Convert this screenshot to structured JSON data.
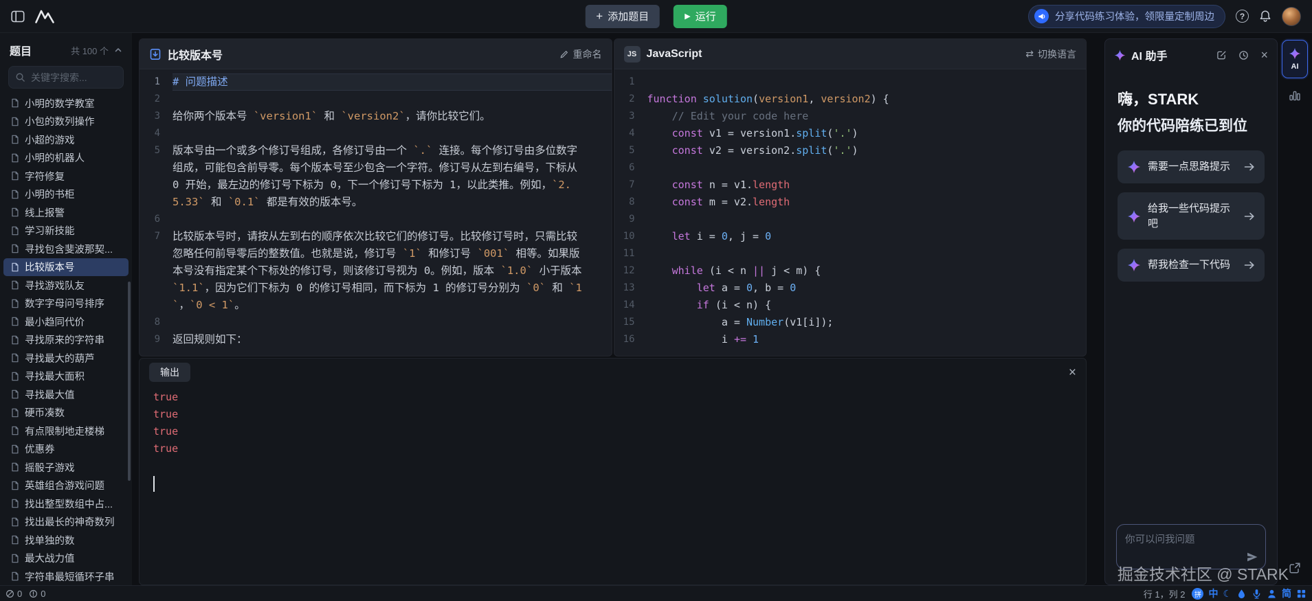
{
  "icons": {
    "plus": "+",
    "play": "▶",
    "help": "?",
    "swap": "⇄",
    "close": "×",
    "badge_js": "JS"
  },
  "topbar": {
    "add_question_label": "添加题目",
    "run_label": "运行",
    "banner_text": "分享代码练习体验，领限量定制周边"
  },
  "sidebar": {
    "title": "题目",
    "count_label": "共 100 个",
    "search_placeholder": "关键字搜索...",
    "items": [
      {
        "label": "小明的数学教室"
      },
      {
        "label": "小包的数列操作"
      },
      {
        "label": "小超的游戏"
      },
      {
        "label": "小明的机器人"
      },
      {
        "label": "字符修复"
      },
      {
        "label": "小明的书柜"
      },
      {
        "label": "线上报警"
      },
      {
        "label": "学习新技能"
      },
      {
        "label": "寻找包含斐波那契..."
      },
      {
        "label": "比较版本号",
        "active": true
      },
      {
        "label": "寻找游戏队友"
      },
      {
        "label": "数字字母问号排序"
      },
      {
        "label": "最小趋同代价"
      },
      {
        "label": "寻找原来的字符串"
      },
      {
        "label": "寻找最大的葫芦"
      },
      {
        "label": "寻找最大面积"
      },
      {
        "label": "寻找最大值"
      },
      {
        "label": "硬币凑数"
      },
      {
        "label": "有点限制地走楼梯"
      },
      {
        "label": "优惠券"
      },
      {
        "label": "摇骰子游戏"
      },
      {
        "label": "英雄组合游戏问题"
      },
      {
        "label": "找出整型数组中占..."
      },
      {
        "label": "找出最长的神奇数列"
      },
      {
        "label": "找单独的数"
      },
      {
        "label": "最大战力值"
      },
      {
        "label": "字符串最短循环子串"
      }
    ]
  },
  "problem": {
    "title": "比较版本号",
    "rename_label": "重命名",
    "lines": [
      {
        "no": 1,
        "active": true,
        "segs": [
          {
            "c": "head",
            "t": "# 问题描述"
          }
        ]
      },
      {
        "no": 2,
        "segs": []
      },
      {
        "no": 3,
        "segs": [
          {
            "c": "txt",
            "t": "给你两个版本号 "
          },
          {
            "c": "code",
            "t": "`version1`"
          },
          {
            "c": "txt",
            "t": " 和 "
          },
          {
            "c": "code",
            "t": "`version2`"
          },
          {
            "c": "txt",
            "t": "，请你比较它们。"
          }
        ]
      },
      {
        "no": 4,
        "segs": []
      },
      {
        "no": 5,
        "segs": [
          {
            "c": "txt",
            "t": "版本号由一个或多个修订号组成，各修订号由一个 "
          },
          {
            "c": "code",
            "t": "`.`"
          },
          {
            "c": "txt",
            "t": " 连接。每个修订号由多位数字组成，可能包含前导零。每个版本号至少包含一个字符。修订号从左到右编号，下标从 0 开始，最左边的修订号下标为 0，下一个修订号下标为 1，以此类推。例如，"
          },
          {
            "c": "code",
            "t": "`2.5.33`"
          },
          {
            "c": "txt",
            "t": " 和 "
          },
          {
            "c": "code",
            "t": "`0.1`"
          },
          {
            "c": "txt",
            "t": " 都是有效的版本号。"
          }
        ]
      },
      {
        "no": 6,
        "segs": []
      },
      {
        "no": 7,
        "segs": [
          {
            "c": "txt",
            "t": "比较版本号时，请按从左到右的顺序依次比较它们的修订号。比较修订号时，只需比较忽略任何前导零后的整数值。也就是说，修订号 "
          },
          {
            "c": "code",
            "t": "`1`"
          },
          {
            "c": "txt",
            "t": " 和修订号 "
          },
          {
            "c": "code",
            "t": "`001`"
          },
          {
            "c": "txt",
            "t": " 相等。如果版本号没有指定某个下标处的修订号，则该修订号视为 0。例如，版本 "
          },
          {
            "c": "code",
            "t": "`1.0`"
          },
          {
            "c": "txt",
            "t": " 小于版本 "
          },
          {
            "c": "code",
            "t": "`1.1`"
          },
          {
            "c": "txt",
            "t": "，因为它们下标为 0 的修订号相同，而下标为 1 的修订号分别为 "
          },
          {
            "c": "code",
            "t": "`0`"
          },
          {
            "c": "txt",
            "t": " 和 "
          },
          {
            "c": "code",
            "t": "`1`"
          },
          {
            "c": "txt",
            "t": "，"
          },
          {
            "c": "code",
            "t": "`0 < 1`"
          },
          {
            "c": "txt",
            "t": "。"
          }
        ]
      },
      {
        "no": 8,
        "segs": []
      },
      {
        "no": 9,
        "segs": [
          {
            "c": "txt",
            "t": "返回规则如下："
          }
        ]
      }
    ]
  },
  "code": {
    "language_label": "JavaScript",
    "switch_label": "切换语言",
    "lines": [
      {
        "no": 1,
        "tokens": []
      },
      {
        "no": 2,
        "tokens": [
          {
            "c": "kw",
            "t": "function "
          },
          {
            "c": "fn",
            "t": "solution"
          },
          {
            "c": "pl",
            "t": "("
          },
          {
            "c": "pa",
            "t": "version1"
          },
          {
            "c": "pl",
            "t": ", "
          },
          {
            "c": "pa",
            "t": "version2"
          },
          {
            "c": "pl",
            "t": ") {"
          }
        ]
      },
      {
        "no": 3,
        "tokens": [
          {
            "c": "pl",
            "t": "    "
          },
          {
            "c": "cmt",
            "t": "// Edit your code here"
          }
        ]
      },
      {
        "no": 4,
        "tokens": [
          {
            "c": "pl",
            "t": "    "
          },
          {
            "c": "kw",
            "t": "const "
          },
          {
            "c": "pl",
            "t": "v1 = version1."
          },
          {
            "c": "fn",
            "t": "split"
          },
          {
            "c": "pl",
            "t": "("
          },
          {
            "c": "str",
            "t": "'.'"
          },
          {
            "c": "pl",
            "t": ")"
          }
        ]
      },
      {
        "no": 5,
        "tokens": [
          {
            "c": "pl",
            "t": "    "
          },
          {
            "c": "kw",
            "t": "const "
          },
          {
            "c": "pl",
            "t": "v2 = version2."
          },
          {
            "c": "fn",
            "t": "split"
          },
          {
            "c": "pl",
            "t": "("
          },
          {
            "c": "str",
            "t": "'.'"
          },
          {
            "c": "pl",
            "t": ")"
          }
        ]
      },
      {
        "no": 6,
        "tokens": []
      },
      {
        "no": 7,
        "tokens": [
          {
            "c": "pl",
            "t": "    "
          },
          {
            "c": "kw",
            "t": "const "
          },
          {
            "c": "pl",
            "t": "n = v1."
          },
          {
            "c": "pr",
            "t": "length"
          }
        ]
      },
      {
        "no": 8,
        "tokens": [
          {
            "c": "pl",
            "t": "    "
          },
          {
            "c": "kw",
            "t": "const "
          },
          {
            "c": "pl",
            "t": "m = v2."
          },
          {
            "c": "pr",
            "t": "length"
          }
        ]
      },
      {
        "no": 9,
        "tokens": []
      },
      {
        "no": 10,
        "tokens": [
          {
            "c": "pl",
            "t": "    "
          },
          {
            "c": "kw",
            "t": "let "
          },
          {
            "c": "pl",
            "t": "i = "
          },
          {
            "c": "num",
            "t": "0"
          },
          {
            "c": "pl",
            "t": ", j = "
          },
          {
            "c": "num",
            "t": "0"
          }
        ]
      },
      {
        "no": 11,
        "tokens": []
      },
      {
        "no": 12,
        "tokens": [
          {
            "c": "pl",
            "t": "    "
          },
          {
            "c": "kw",
            "t": "while "
          },
          {
            "c": "pl",
            "t": "(i < n "
          },
          {
            "c": "kw",
            "t": "||"
          },
          {
            "c": "pl",
            "t": " j < m) {"
          }
        ]
      },
      {
        "no": 13,
        "tokens": [
          {
            "c": "pl",
            "t": "        "
          },
          {
            "c": "kw",
            "t": "let "
          },
          {
            "c": "pl",
            "t": "a = "
          },
          {
            "c": "num",
            "t": "0"
          },
          {
            "c": "pl",
            "t": ", b = "
          },
          {
            "c": "num",
            "t": "0"
          }
        ]
      },
      {
        "no": 14,
        "tokens": [
          {
            "c": "pl",
            "t": "        "
          },
          {
            "c": "kw",
            "t": "if "
          },
          {
            "c": "pl",
            "t": "(i < n) {"
          }
        ]
      },
      {
        "no": 15,
        "tokens": [
          {
            "c": "pl",
            "t": "            a = "
          },
          {
            "c": "fn",
            "t": "Number"
          },
          {
            "c": "pl",
            "t": "(v1[i]);"
          }
        ]
      },
      {
        "no": 16,
        "tokens": [
          {
            "c": "pl",
            "t": "            i "
          },
          {
            "c": "kw",
            "t": "+="
          },
          {
            "c": "pl",
            "t": " "
          },
          {
            "c": "num",
            "t": "1"
          }
        ]
      }
    ]
  },
  "output": {
    "tab_label": "输出",
    "lines": [
      "true",
      "true",
      "true",
      "true"
    ]
  },
  "ai": {
    "title": "AI 助手",
    "greeting_line1": "嗨，STARK",
    "greeting_line2": "你的代码陪练已到位",
    "suggestions": [
      {
        "label": "需要一点思路提示"
      },
      {
        "label": "给我一些代码提示吧"
      },
      {
        "label": "帮我检查一下代码"
      }
    ],
    "input_placeholder": "你可以问我问题"
  },
  "right_strip": {
    "ai_tab_label": "AI"
  },
  "statusbar": {
    "errors": "0",
    "warnings": "0",
    "position": "行 1，列 2",
    "ime": {
      "pinyin": "拼",
      "chinese": "中",
      "moon": "☾",
      "simplified": "简"
    }
  },
  "watermark": "掘金技术社区 @ STARK"
}
